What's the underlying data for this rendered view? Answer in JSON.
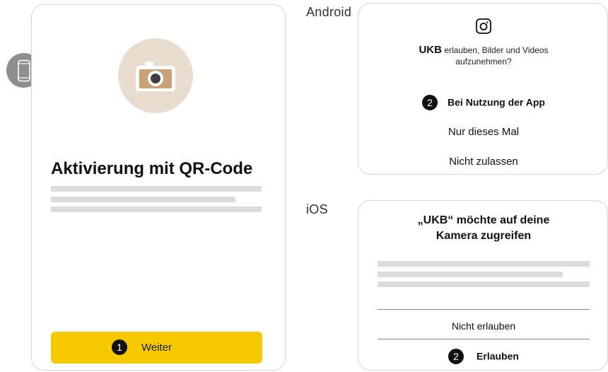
{
  "main_screen": {
    "title": "Aktivierung mit QR-Code",
    "weiter_button": {
      "step": "1",
      "label": "Weiter"
    },
    "accent_color": "#f7c900"
  },
  "android": {
    "platform_label": "Android",
    "app_name": "UKB",
    "prompt_line1": "erlauben, Bilder und Videos",
    "prompt_line2": "aufzunehmen?",
    "options": [
      {
        "step": "2",
        "label": "Bei Nutzung der App"
      },
      {
        "label": "Nur dieses Mal"
      },
      {
        "label": "Nicht zulassen"
      }
    ]
  },
  "ios": {
    "platform_label": "iOS",
    "title_line1": "„UKB“ möchte auf deine",
    "title_line2": "Kamera zugreifen",
    "deny_label": "Nicht erlauben",
    "allow": {
      "step": "2",
      "label": "Erlauben"
    }
  }
}
